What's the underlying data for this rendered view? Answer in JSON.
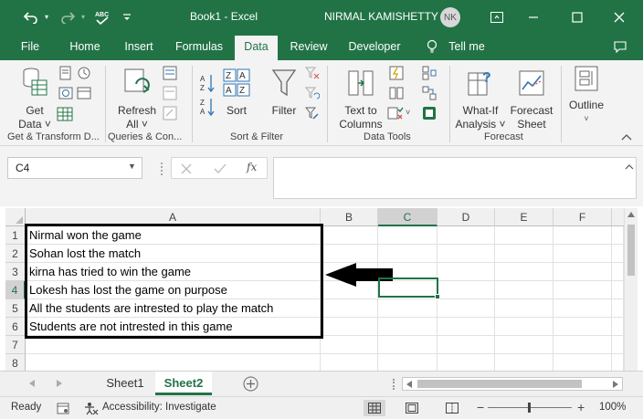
{
  "window": {
    "title": "Book1  -  Excel",
    "user_name": "NIRMAL KAMISHETTY",
    "user_initials": "NK",
    "accent_color": "#217346"
  },
  "quick_access": {
    "undo_icon": "undo-icon",
    "redo_icon": "redo-icon",
    "spelling_icon": "spelling-abc-icon",
    "customize_icon": "dropdown-caret-icon"
  },
  "ribbon_tabs": [
    {
      "label": "File"
    },
    {
      "label": "Home"
    },
    {
      "label": "Insert"
    },
    {
      "label": "Formulas"
    },
    {
      "label": "Data"
    },
    {
      "label": "Review"
    },
    {
      "label": "Developer"
    },
    {
      "label": "Tell me"
    }
  ],
  "active_tab": "Data",
  "ribbon": {
    "get_data": {
      "line1": "Get",
      "line2": "Data ˅"
    },
    "refresh_all": {
      "line1": "Refresh",
      "line2": "All ˅"
    },
    "sort": {
      "label": "Sort"
    },
    "filter": {
      "label": "Filter"
    },
    "text_to_columns": {
      "line1": "Text to",
      "line2": "Columns"
    },
    "what_if": {
      "line1": "What-If",
      "line2": "Analysis ˅"
    },
    "forecast_sheet": {
      "line1": "Forecast",
      "line2": "Sheet"
    },
    "outline": {
      "label": "Outline"
    },
    "groups": [
      {
        "label": "Get & Transform D..."
      },
      {
        "label": "Queries & Con..."
      },
      {
        "label": "Sort & Filter"
      },
      {
        "label": "Data Tools"
      },
      {
        "label": "Forecast"
      }
    ]
  },
  "formula_bar": {
    "name_box": "C4",
    "formula": ""
  },
  "grid": {
    "columns": [
      "A",
      "B",
      "C",
      "D",
      "E",
      "F"
    ],
    "selected_column": "C",
    "rows": [
      "1",
      "2",
      "3",
      "4",
      "5",
      "6",
      "7",
      "8"
    ],
    "selected_row": "4",
    "cells_A": [
      "Nirmal won the game",
      "Sohan lost the match",
      "kirna has tried to win the game",
      "Lokesh has lost the game on purpose",
      "All the students are intrested to play the match",
      "Students are not intrested in this game",
      "",
      ""
    ]
  },
  "sheets": [
    {
      "label": "Sheet1"
    },
    {
      "label": "Sheet2"
    }
  ],
  "active_sheet": "Sheet2",
  "status": {
    "ready": "Ready",
    "accessibility": "Accessibility: Investigate",
    "zoom": "100%"
  }
}
